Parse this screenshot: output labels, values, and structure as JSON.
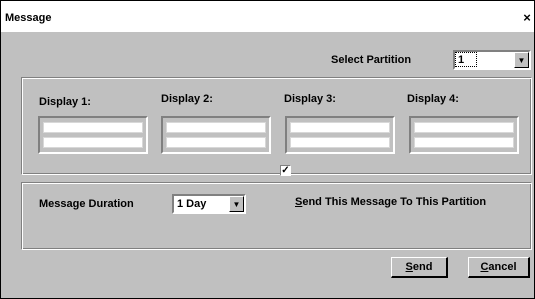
{
  "window": {
    "title": "Message",
    "close_glyph": "×"
  },
  "partition": {
    "label": "Select Partition",
    "value": "1"
  },
  "displays": [
    {
      "label": "Display 1:"
    },
    {
      "label": "Display 2:"
    },
    {
      "label": "Display 3:"
    },
    {
      "label": "Display 4:"
    }
  ],
  "duration": {
    "label": "Message Duration",
    "value": "1 Day"
  },
  "send_partition": {
    "checked": true,
    "mnemonic": "S",
    "rest": "end This  Message To This Partition"
  },
  "buttons": {
    "send": {
      "mnemonic": "S",
      "rest": "end"
    },
    "cancel": {
      "mnemonic": "C",
      "rest": "ancel"
    }
  }
}
